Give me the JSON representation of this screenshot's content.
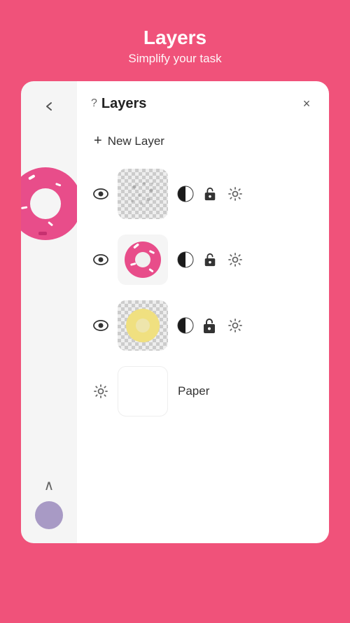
{
  "header": {
    "title": "Layers",
    "subtitle": "Simplify your task"
  },
  "panel": {
    "title": "Layers",
    "question_mark": "?",
    "new_layer_label": "New Layer",
    "plus_symbol": "+",
    "close_symbol": "×"
  },
  "layers": [
    {
      "id": "layer1",
      "type": "scatter",
      "visible": true
    },
    {
      "id": "layer2",
      "type": "donut-pink",
      "visible": true
    },
    {
      "id": "layer3",
      "type": "donut-yellow",
      "visible": true
    }
  ],
  "paper_layer": {
    "label": "Paper"
  },
  "bottom_nav": {
    "chevron": "∧",
    "avatar_color": "#a89ac5"
  }
}
